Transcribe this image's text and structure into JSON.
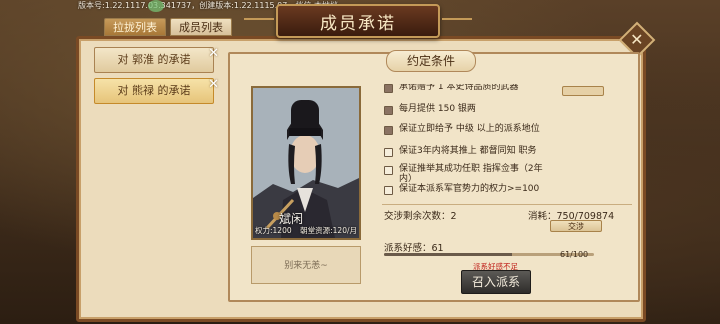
{
  "version": "版本号:1.22.1117.03.341737，创建版本:1.22.1115.07，档位:本地档",
  "title": "成员承诺",
  "tabs": [
    {
      "label": "拉拢列表",
      "active": true
    },
    {
      "label": "成员列表",
      "active": false
    }
  ],
  "left_list": [
    {
      "label": "对 郭淮 的承诺",
      "selected": false
    },
    {
      "label": "对 熊禄 的承诺",
      "selected": true
    }
  ],
  "inner_header": "约定条件",
  "character": {
    "name": "斌闲",
    "power": "权力:1200",
    "resource": "朝堂资源:120/月",
    "wish": "别来无恙~"
  },
  "conditions": [
    {
      "text": "承诺赠予 1 本史诗品质的武器",
      "checked": true
    },
    {
      "text": "每月提供 150 银两",
      "checked": true
    },
    {
      "text": "保证立即给予 中级 以上的派系地位",
      "checked": true
    },
    {
      "text": "保证3年内将其推上 都督同知 职务",
      "checked": false
    },
    {
      "text": "保证推举其成功任职 指挥佥事（2年内）",
      "checked": false
    },
    {
      "text": "保证本派系军官势力的权力>=100",
      "checked": false
    }
  ],
  "negotiate": {
    "label": "交涉剩余次数：",
    "value": "2"
  },
  "consume": {
    "label": "消耗：",
    "value": "750/709874"
  },
  "exchange_label": "交涉",
  "favor": {
    "label": "派系好感：",
    "value": "61",
    "count": "61/100",
    "fraction": 0.61
  },
  "warning": "派系好感不足",
  "summon_label": "召入派系",
  "close_glyph": "✕",
  "remove_glyph": "✕"
}
